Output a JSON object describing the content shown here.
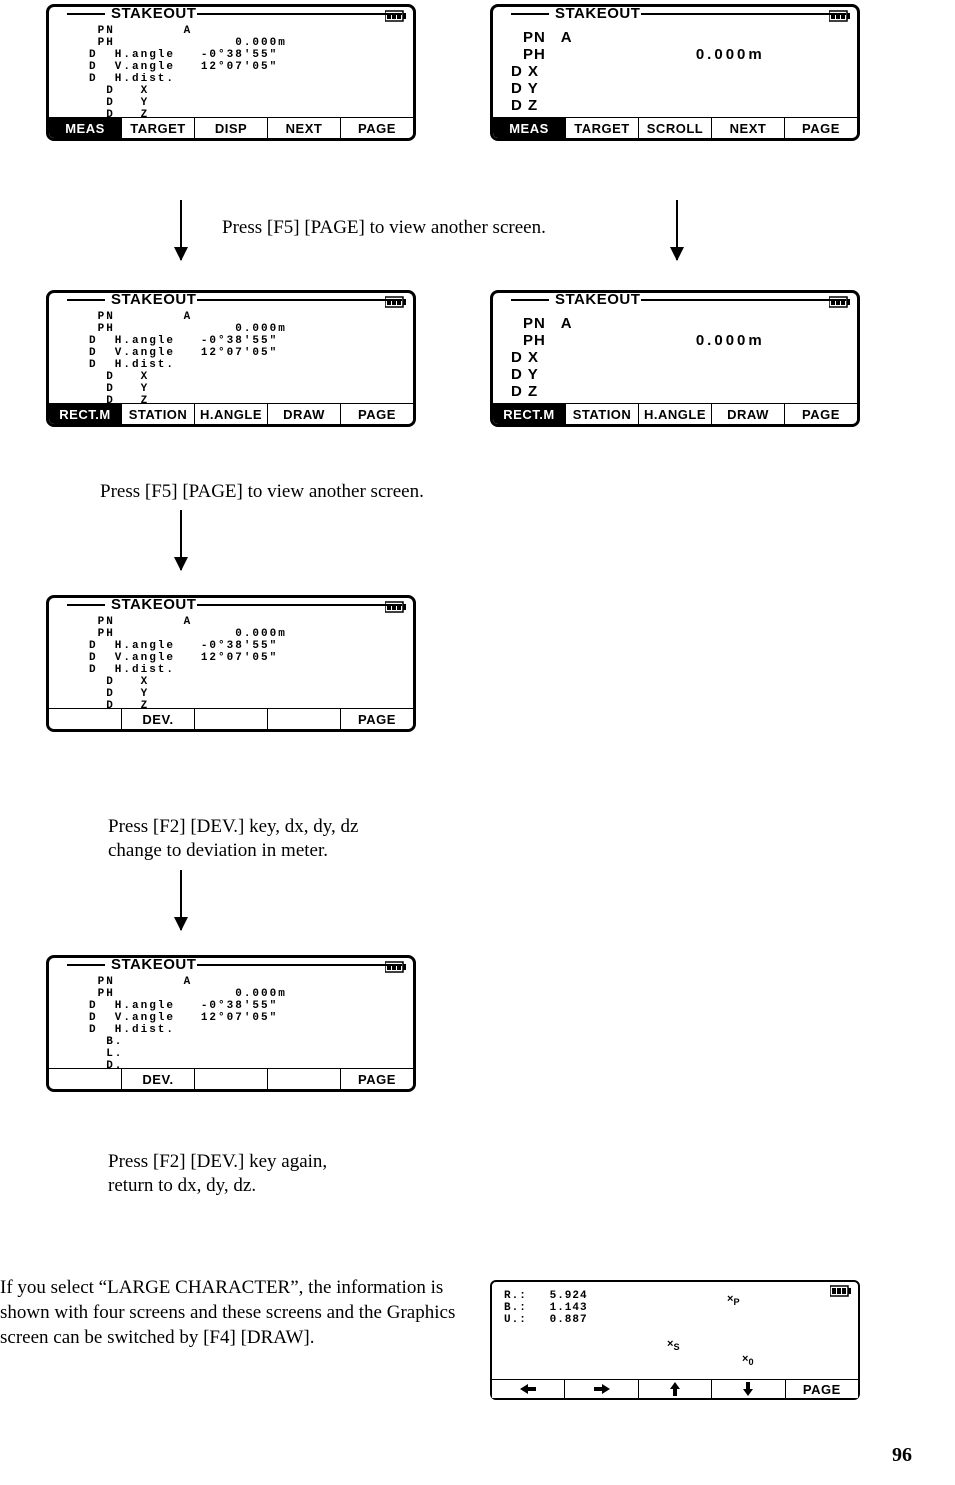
{
  "screens": {
    "topLeft": {
      "title": "STAKEOUT",
      "softkeys": [
        "MEAS",
        "TARGET",
        "DISP",
        "NEXT",
        "PAGE"
      ]
    },
    "topRight": {
      "title": "STAKEOUT",
      "PN": "PN",
      "PNval": "A",
      "PH": "PH",
      "PHval": "0.000m",
      "rows": [
        "D X",
        "D Y",
        "D Z"
      ],
      "softkeys": [
        "MEAS",
        "TARGET",
        "SCROLL",
        "NEXT",
        "PAGE"
      ]
    },
    "midLeft": {
      "title": "STAKEOUT",
      "softkeys": [
        "RECT.M",
        "STATION",
        "H.ANGLE",
        "DRAW",
        "PAGE"
      ]
    },
    "midRight": {
      "title": "STAKEOUT",
      "PN": "PN",
      "PNval": "A",
      "PH": "PH",
      "PHval": "0.000m",
      "rows": [
        "D X",
        "D Y",
        "D Z"
      ],
      "softkeys": [
        "RECT.M",
        "STATION",
        "H.ANGLE",
        "DRAW",
        "PAGE"
      ]
    },
    "screen3": {
      "title": "STAKEOUT",
      "softkeys": [
        "",
        "DEV.",
        "",
        "",
        "PAGE"
      ]
    },
    "screen4": {
      "title": "STAKEOUT",
      "softkeys": [
        "",
        "DEV.",
        "",
        "",
        "PAGE"
      ]
    },
    "graphics": {
      "R": "R.:   5.924",
      "B": "B.:   1.143",
      "U": "U.:   0.887",
      "softkeys": [
        "←",
        "→",
        "↑",
        "↓",
        "PAGE"
      ]
    }
  },
  "denseBlock": {
    "l1": " PN        A",
    "l2": " PH              0.000m",
    "l3": "D  H.angle   -0°38′55″",
    "l4": "D  V.angle   12°07′05″",
    "l5": "D  H.dist.",
    "l6": "  D   X",
    "l7": "  D   Y",
    "l8": "  D   Z"
  },
  "denseBlock2": {
    "l1": " PN        A",
    "l2": " PH              0.000m",
    "l3": "D  H.angle   -0°38′55″",
    "l4": "D  V.angle   12°07′05″",
    "l5": "D  H.dist.",
    "l6": "  B.",
    "l7": "  L.",
    "l8": "  D."
  },
  "captions": {
    "c1": "Press [F5] [PAGE] to view another screen.",
    "c2": "Press [F5] [PAGE] to view another screen.",
    "c3a": "Press [F2] [DEV.] key, dx, dy, dz",
    "c3b": "change to deviation in meter.",
    "c4a": "Press [F2] [DEV.] key again,",
    "c4b": "return to dx, dy, dz.",
    "para": "If you select “LARGE CHARACTER”, the information is shown with four screens and these screens and the Graphics screen can be switched by [F4] [DRAW]."
  },
  "labels": {
    "xp": "P",
    "xs": "S",
    "x0": "0"
  },
  "pagenum": "96"
}
